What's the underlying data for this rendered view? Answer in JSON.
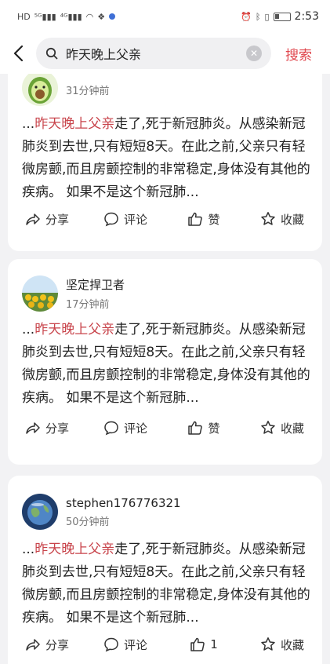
{
  "status_bar": {
    "left_icons": [
      "HD",
      "5G",
      "4G",
      "wifi",
      "nfc"
    ],
    "time": "2:53"
  },
  "header": {
    "search_query": "昨天晚上父亲",
    "search_button": "搜索"
  },
  "posts": [
    {
      "username": "",
      "time": "31分钟前",
      "highlight": "昨天晚上父亲",
      "text_after": "走了,死于新冠肺炎。从感染新冠肺炎到去世,只有短短8天。在此之前,父亲只有轻微房颤,而且房颤控制的非常稳定,身体没有其他的疾病。 如果不是这个新冠肺...",
      "prefix": "...",
      "actions": [
        "分享",
        "评论",
        "赞",
        "收藏"
      ]
    },
    {
      "username": "坚定捍卫者",
      "time": "17分钟前",
      "highlight": "昨天晚上父亲",
      "text_after": "走了,死于新冠肺炎。从感染新冠肺炎到去世,只有短短8天。在此之前,父亲只有轻微房颤,而且房颤控制的非常稳定,身体没有其他的疾病。 如果不是这个新冠肺...",
      "prefix": "...",
      "actions": [
        "分享",
        "评论",
        "赞",
        "收藏"
      ]
    },
    {
      "username": "stephen176776321",
      "time": "50分钟前",
      "highlight": "昨天晚上父亲",
      "text_after": "走了,死于新冠肺炎。从感染新冠肺炎到去世,只有短短8天。在此之前,父亲只有轻微房颤,而且房颤控制的非常稳定,身体没有其他的疾病。 如果不是这个新冠肺...",
      "prefix": "...",
      "actions": [
        "分享",
        "评论",
        "1",
        "收藏"
      ]
    }
  ],
  "colors": {
    "accent": "#e0464d",
    "highlight": "#c8444b",
    "background": "#f2f2f4"
  }
}
